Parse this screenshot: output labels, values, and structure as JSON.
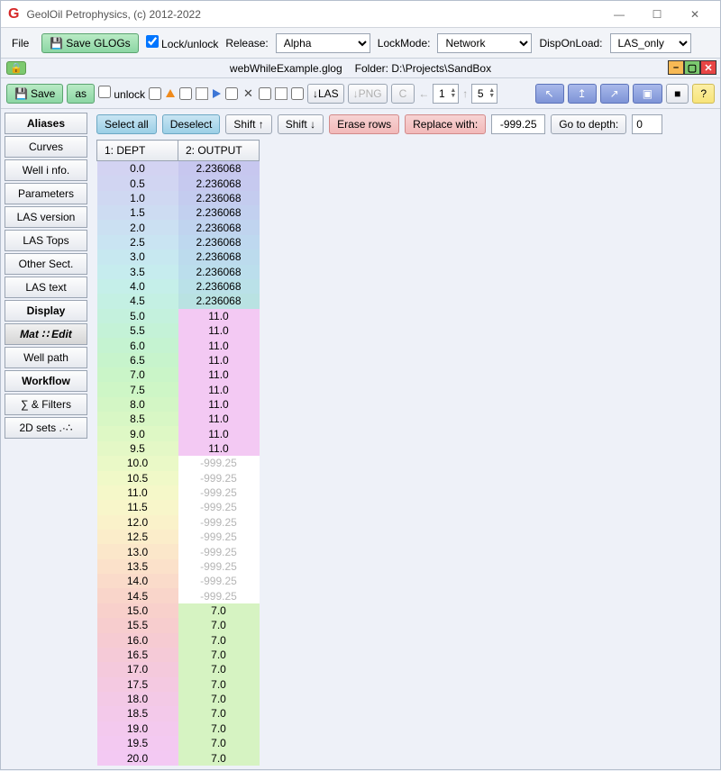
{
  "title": "GeolOil Petrophysics, (c) 2012-2022",
  "menubar": {
    "file": "File",
    "save_glogs": "Save GLOGs",
    "lock_unlock": "Lock/unlock",
    "release_label": "Release:",
    "release_value": "Alpha",
    "lockmode_label": "LockMode:",
    "lockmode_value": "Network",
    "disponload_label": "DispOnLoad:",
    "disponload_value": "LAS_only"
  },
  "doc": {
    "filename": "webWhileExample.glog",
    "folder_label": "Folder:",
    "folder_path": "D:\\Projects\\SandBox"
  },
  "toolbar2": {
    "save": "Save",
    "as": "as",
    "unlock": "unlock",
    "las": "↓LAS",
    "png": "↓PNG",
    "c": "C",
    "left": "←",
    "leftn": "1",
    "right": "↑",
    "rightn": "5",
    "help": "?"
  },
  "sidebar": {
    "items": [
      "Aliases",
      "Curves",
      "Well i nfo.",
      "Parameters",
      "LAS version",
      "LAS Tops",
      "Other Sect.",
      "LAS text",
      "Display",
      "Mat ∷ Edit",
      "Well path",
      "Workflow",
      "∑ & Filters",
      "2D sets .·∴"
    ]
  },
  "actions": {
    "select_all": "Select all",
    "deselect": "Deselect",
    "shift_up": "Shift ↑",
    "shift_down": "Shift ↓",
    "erase_rows": "Erase rows",
    "replace_with": "Replace with:",
    "replace_val": "-999.25",
    "goto": "Go to depth:",
    "goto_val": "0"
  },
  "table": {
    "col1": "1: DEPT",
    "col2": "2: OUTPUT",
    "rows": [
      {
        "d": "0.0",
        "o": "2.236068",
        "c1": "#d3d3f2",
        "c2": "#c7c7ef"
      },
      {
        "d": "0.5",
        "o": "2.236068",
        "c1": "#d1d5f2",
        "c2": "#c6c9ef"
      },
      {
        "d": "1.0",
        "o": "2.236068",
        "c1": "#cfd8f2",
        "c2": "#c4ccef"
      },
      {
        "d": "1.5",
        "o": "2.236068",
        "c1": "#cddcf2",
        "c2": "#c2d0ef"
      },
      {
        "d": "2.0",
        "o": "2.236068",
        "c1": "#cbe0f2",
        "c2": "#c0d4ef"
      },
      {
        "d": "2.5",
        "o": "2.236068",
        "c1": "#c9e4f2",
        "c2": "#bed8ef"
      },
      {
        "d": "3.0",
        "o": "2.236068",
        "c1": "#c7e8f0",
        "c2": "#bcdbed"
      },
      {
        "d": "3.5",
        "o": "2.236068",
        "c1": "#c6ecee",
        "c2": "#bbdeec"
      },
      {
        "d": "4.0",
        "o": "2.236068",
        "c1": "#c5efe9",
        "c2": "#bae1e8"
      },
      {
        "d": "4.5",
        "o": "2.236068",
        "c1": "#c4f0e3",
        "c2": "#b9e2e2"
      },
      {
        "d": "5.0",
        "o": "11.0",
        "c1": "#c4f1dd",
        "c2": "#f3c9f3"
      },
      {
        "d": "5.5",
        "o": "11.0",
        "c1": "#c4f2d7",
        "c2": "#f3c9f3"
      },
      {
        "d": "6.0",
        "o": "11.0",
        "c1": "#c5f3d1",
        "c2": "#f3c9f3"
      },
      {
        "d": "6.5",
        "o": "11.0",
        "c1": "#c7f4cc",
        "c2": "#f3c9f3"
      },
      {
        "d": "7.0",
        "o": "11.0",
        "c1": "#caf5c8",
        "c2": "#f3c9f3"
      },
      {
        "d": "7.5",
        "o": "11.0",
        "c1": "#cef6c6",
        "c2": "#f3c9f3"
      },
      {
        "d": "8.0",
        "o": "11.0",
        "c1": "#d3f6c5",
        "c2": "#f3c9f3"
      },
      {
        "d": "8.5",
        "o": "11.0",
        "c1": "#d8f7c5",
        "c2": "#f3c9f3"
      },
      {
        "d": "9.0",
        "o": "11.0",
        "c1": "#def8c5",
        "c2": "#f3c9f3"
      },
      {
        "d": "9.5",
        "o": "11.0",
        "c1": "#e4f8c6",
        "c2": "#f3c9f3"
      },
      {
        "d": "10.0",
        "o": "-999.25",
        "c1": "#eaf9c7",
        "c2": "#ffffff",
        "null": true
      },
      {
        "d": "10.5",
        "o": "-999.25",
        "c1": "#f0f9c8",
        "c2": "#ffffff",
        "null": true
      },
      {
        "d": "11.0",
        "o": "-999.25",
        "c1": "#f5f8c9",
        "c2": "#ffffff",
        "null": true
      },
      {
        "d": "11.5",
        "o": "-999.25",
        "c1": "#f8f6ca",
        "c2": "#ffffff",
        "null": true
      },
      {
        "d": "12.0",
        "o": "-999.25",
        "c1": "#faf2ca",
        "c2": "#ffffff",
        "null": true
      },
      {
        "d": "12.5",
        "o": "-999.25",
        "c1": "#fbedca",
        "c2": "#ffffff",
        "null": true
      },
      {
        "d": "13.0",
        "o": "-999.25",
        "c1": "#fbe7ca",
        "c2": "#ffffff",
        "null": true
      },
      {
        "d": "13.5",
        "o": "-999.25",
        "c1": "#fbe1ca",
        "c2": "#ffffff",
        "null": true
      },
      {
        "d": "14.0",
        "o": "-999.25",
        "c1": "#fadbca",
        "c2": "#ffffff",
        "null": true
      },
      {
        "d": "14.5",
        "o": "-999.25",
        "c1": "#f9d5ca",
        "c2": "#ffffff",
        "null": true
      },
      {
        "d": "15.0",
        "o": "7.0",
        "c1": "#f8d0cb",
        "c2": "#d6f3c2"
      },
      {
        "d": "15.5",
        "o": "7.0",
        "c1": "#f7cdce",
        "c2": "#d6f3c2"
      },
      {
        "d": "16.0",
        "o": "7.0",
        "c1": "#f6cbd2",
        "c2": "#d6f3c2"
      },
      {
        "d": "16.5",
        "o": "7.0",
        "c1": "#f5cad7",
        "c2": "#d6f3c2"
      },
      {
        "d": "17.0",
        "o": "7.0",
        "c1": "#f4c9dc",
        "c2": "#d6f3c2"
      },
      {
        "d": "17.5",
        "o": "7.0",
        "c1": "#f4c9e1",
        "c2": "#d6f3c2"
      },
      {
        "d": "18.0",
        "o": "7.0",
        "c1": "#f3c9e6",
        "c2": "#d6f3c2"
      },
      {
        "d": "18.5",
        "o": "7.0",
        "c1": "#f3c9ea",
        "c2": "#d6f3c2"
      },
      {
        "d": "19.0",
        "o": "7.0",
        "c1": "#f3c9ee",
        "c2": "#d6f3c2"
      },
      {
        "d": "19.5",
        "o": "7.0",
        "c1": "#f3c9f1",
        "c2": "#d6f3c2"
      },
      {
        "d": "20.0",
        "o": "7.0",
        "c1": "#f3c9f3",
        "c2": "#d6f3c2"
      }
    ]
  }
}
